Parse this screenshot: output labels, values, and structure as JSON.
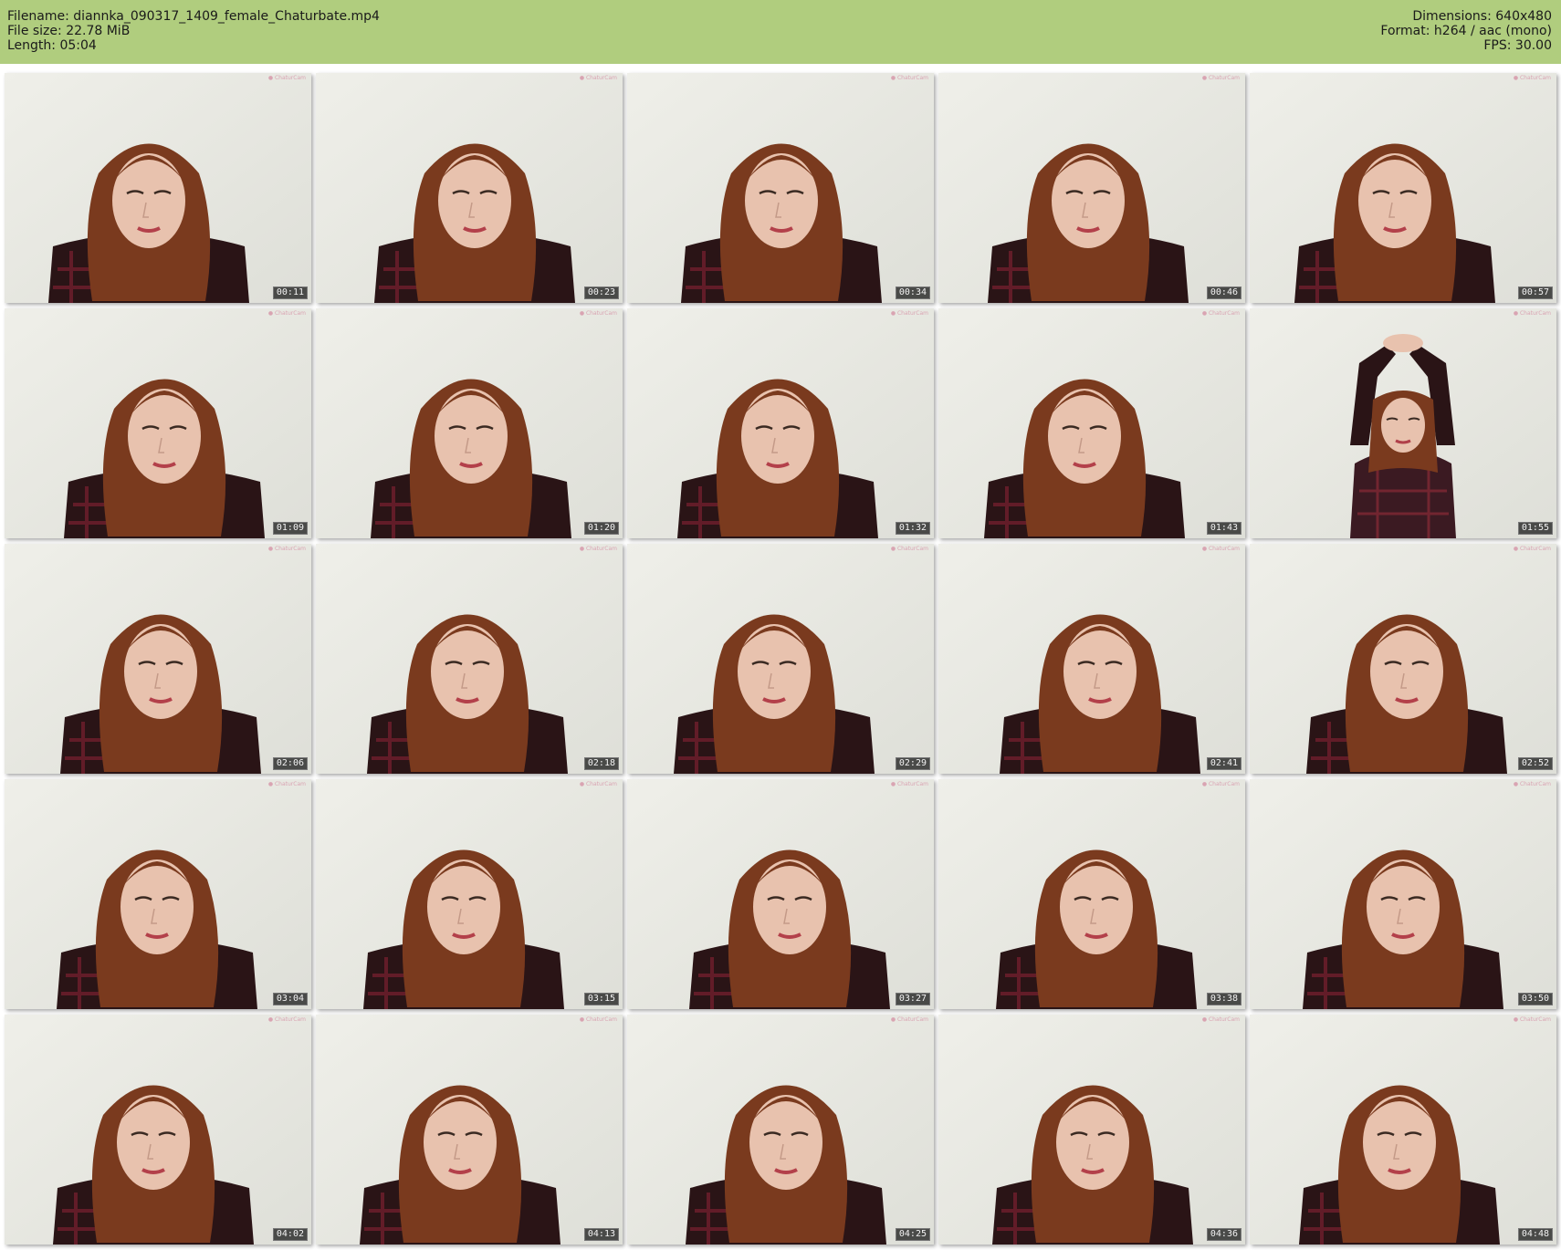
{
  "header": {
    "filename": "Filename: diannka_090317_1409_female_Chaturbate.mp4",
    "filesize": "File size: 22.78 MiB",
    "length": "Length: 05:04",
    "dimensions": "Dimensions: 640x480",
    "format": "Format: h264 / aac (mono)",
    "fps": "FPS: 30.00"
  },
  "frames": [
    {
      "time": "00:11"
    },
    {
      "time": "00:23"
    },
    {
      "time": "00:34"
    },
    {
      "time": "00:46"
    },
    {
      "time": "00:57"
    },
    {
      "time": "01:09"
    },
    {
      "time": "01:20"
    },
    {
      "time": "01:32"
    },
    {
      "time": "01:43"
    },
    {
      "time": "01:55",
      "pose": "arms-raised"
    },
    {
      "time": "02:06"
    },
    {
      "time": "02:18"
    },
    {
      "time": "02:29"
    },
    {
      "time": "02:41"
    },
    {
      "time": "02:52"
    },
    {
      "time": "03:04"
    },
    {
      "time": "03:15"
    },
    {
      "time": "03:27"
    },
    {
      "time": "03:38"
    },
    {
      "time": "03:50"
    },
    {
      "time": "04:02"
    },
    {
      "time": "04:13"
    },
    {
      "time": "04:25"
    },
    {
      "time": "04:36"
    },
    {
      "time": "04:48"
    }
  ],
  "colors": {
    "header_bg": "#b0cd7e",
    "wall": "#e9e9e4",
    "hair": "#7a3a1e",
    "skin": "#e8c2ae",
    "shirt": "#2a1416"
  }
}
